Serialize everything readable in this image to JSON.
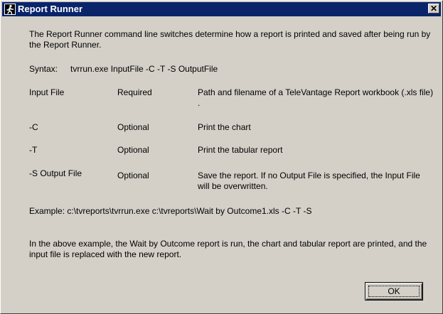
{
  "window": {
    "title": "Report Runner",
    "close_glyph": "✕",
    "icon": "report-runner-icon"
  },
  "intro": "The Report Runner command line switches determine how a report is printed and saved after being run by the Report Runner.",
  "syntax": {
    "label": "Syntax:",
    "command": "tvrrun.exe  InputFile -C  -T  -S  OutputFile"
  },
  "switches": [
    {
      "name": "Input File",
      "status": "Required",
      "description": "Path and filename of a TeleVantage Report workbook (.xls file) ."
    },
    {
      "name": "-C",
      "status": "Optional",
      "description": "Print the chart"
    },
    {
      "name": "-T",
      "status": "Optional",
      "description": "Print the tabular report"
    },
    {
      "name": "-S Output File",
      "status": "Optional",
      "description": "Save the report.  If no Output File is specified, the Input File will be overwritten."
    }
  ],
  "example": "Example:  c:\\tvreports\\tvrrun.exe c:\\tvreports\\Wait by Outcome1.xls -C -T -S",
  "explanation": "In the above example, the Wait by Outcome report is run, the chart and tabular report are printed, and the input file is replaced with the new report.",
  "ok_label": "OK",
  "colors": {
    "titlebar": "#0a246a",
    "face": "#d4d0c8"
  }
}
